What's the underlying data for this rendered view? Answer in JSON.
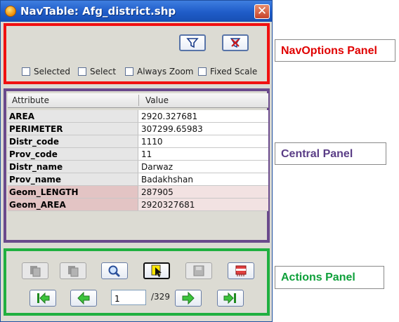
{
  "window": {
    "title": "NavTable: Afg_district.shp"
  },
  "nav_options": {
    "buttons": [
      {
        "name": "filter",
        "icon": "funnel-icon"
      },
      {
        "name": "clear-filter",
        "icon": "no-filter-icon"
      }
    ],
    "checkboxes": [
      {
        "label": "Selected",
        "checked": false
      },
      {
        "label": "Select",
        "checked": false
      },
      {
        "label": "Always Zoom",
        "checked": false
      },
      {
        "label": "Fixed Scale",
        "checked": false
      }
    ]
  },
  "table": {
    "columns": [
      "Attribute",
      "Value"
    ],
    "rows": [
      {
        "attribute": "AREA",
        "value": "2920.327681"
      },
      {
        "attribute": "PERIMETER",
        "value": "307299.65983"
      },
      {
        "attribute": "Distr_code",
        "value": "1110"
      },
      {
        "attribute": "Prov_code",
        "value": "11"
      },
      {
        "attribute": "Distr_name",
        "value": "Darwaz"
      },
      {
        "attribute": "Prov_name",
        "value": "Badakhshan"
      },
      {
        "attribute": "Geom_LENGTH",
        "value": "287905"
      },
      {
        "attribute": "Geom_AREA",
        "value": "2920327681"
      }
    ]
  },
  "actions": {
    "tools": [
      {
        "name": "copy-feature",
        "icon": "copy-icon",
        "enabled": false
      },
      {
        "name": "copy-previous",
        "icon": "copy-icon",
        "enabled": false
      },
      {
        "name": "zoom-to-feature",
        "icon": "magnifier-icon",
        "enabled": true
      },
      {
        "name": "select-feature",
        "icon": "select-cursor-icon",
        "enabled": true
      },
      {
        "name": "save-feature",
        "icon": "save-icon",
        "enabled": false
      },
      {
        "name": "delete-feature",
        "icon": "delete-icon",
        "enabled": true
      }
    ],
    "navigation": {
      "current_record": "1",
      "total_label": "/329"
    }
  },
  "callouts": {
    "navoptions": "NavOptions Panel",
    "central": "Central Panel",
    "actions": "Actions Panel"
  },
  "colors": {
    "navoptions_border": "#f01010",
    "central_border": "#6a4a8c",
    "actions_border": "#20b040",
    "titlebar": "#1f5cc8"
  }
}
